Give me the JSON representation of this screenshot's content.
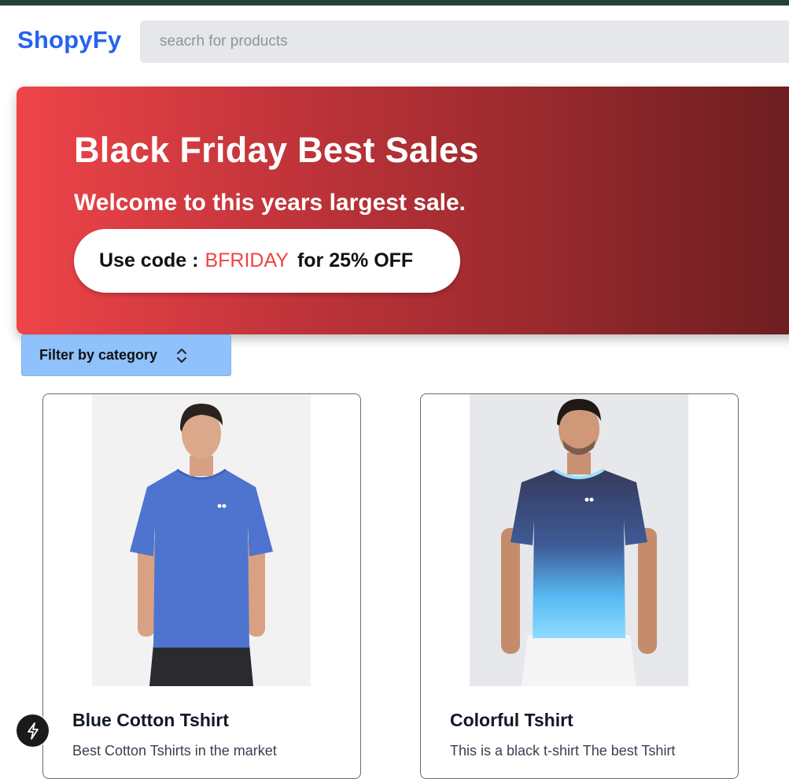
{
  "header": {
    "logo": "ShopyFy",
    "search_placeholder": "seacrh for products"
  },
  "hero": {
    "title": "Black Friday Best Sales",
    "subtitle": "Welcome to this years largest sale.",
    "promo_prefix": "Use code :",
    "promo_code": "BFRIDAY",
    "promo_suffix": "for 25% OFF"
  },
  "filter": {
    "label": "Filter by category"
  },
  "products": [
    {
      "title": "Blue Cotton Tshirt",
      "description": "Best Cotton Tshirts in the market"
    },
    {
      "title": "Colorful Tshirt",
      "description": "This is a black t-shirt The best Tshirt"
    }
  ],
  "colors": {
    "brand": "#2563eb",
    "promo_code": "#ef4444",
    "filter_bg": "#8fc1fb"
  }
}
